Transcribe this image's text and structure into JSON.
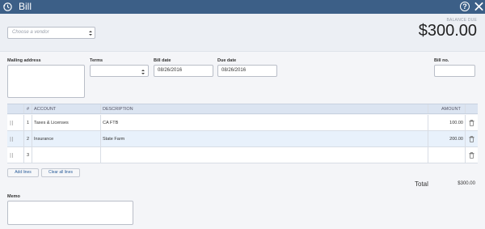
{
  "titlebar": {
    "title": "Bill"
  },
  "header": {
    "vendor_placeholder": "Choose a vendor",
    "balance_due_label": "BALANCE DUE",
    "balance_due_amount": "$300.00"
  },
  "fields": {
    "mailing_address_label": "Mailing address",
    "terms_label": "Terms",
    "bill_date_label": "Bill date",
    "bill_date_value": "08/26/2016",
    "due_date_label": "Due date",
    "due_date_value": "08/26/2016",
    "bill_no_label": "Bill no."
  },
  "table": {
    "headers": {
      "num": "#",
      "account": "ACCOUNT",
      "description": "DESCRIPTION",
      "amount": "AMOUNT"
    },
    "rows": [
      {
        "num": "1",
        "account": "Taxes & Licenses",
        "description": "CA FTB",
        "amount": "100.00"
      },
      {
        "num": "2",
        "account": "Insurance",
        "description": "State Farm",
        "amount": "200.00"
      },
      {
        "num": "3",
        "account": "",
        "description": "",
        "amount": ""
      }
    ]
  },
  "actions": {
    "add_lines": "Add lines",
    "clear_all_lines": "Clear all lines"
  },
  "totals": {
    "label": "Total",
    "value": "$300.00"
  },
  "memo": {
    "label": "Memo"
  }
}
